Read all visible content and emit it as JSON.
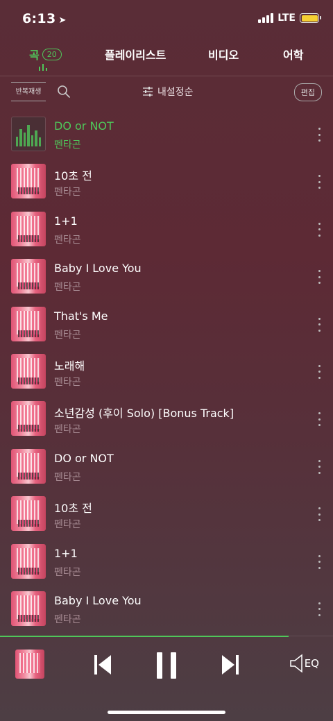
{
  "status_bar": {
    "time": "6:13",
    "network": "LTE"
  },
  "tabs": [
    {
      "label": "곡",
      "count": "20",
      "active": true
    },
    {
      "label": "플레이리스트"
    },
    {
      "label": "비디오"
    },
    {
      "label": "어학"
    }
  ],
  "toolbar": {
    "repeat_label": "반복재생",
    "sort_label": "내설정순",
    "edit_label": "편집"
  },
  "songs": [
    {
      "title": "DO or NOT",
      "artist": "펜타곤",
      "playing": true
    },
    {
      "title": "10초 전",
      "artist": "펜타곤"
    },
    {
      "title": "1+1",
      "artist": "펜타곤"
    },
    {
      "title": "Baby I Love You",
      "artist": "펜타곤"
    },
    {
      "title": "That's Me",
      "artist": "펜타곤"
    },
    {
      "title": "노래해",
      "artist": "펜타곤"
    },
    {
      "title": "소년감성 (후이 Solo) [Bonus Track]",
      "artist": "펜타곤"
    },
    {
      "title": "DO or NOT",
      "artist": "펜타곤"
    },
    {
      "title": "10초 전",
      "artist": "펜타곤"
    },
    {
      "title": "1+1",
      "artist": "펜타곤"
    },
    {
      "title": "Baby I Love You",
      "artist": "펜타곤"
    }
  ],
  "player": {
    "eq_label": "EQ",
    "progress": 0.867
  },
  "colors": {
    "accent": "#4fc75a",
    "background": "#5a2d37"
  }
}
